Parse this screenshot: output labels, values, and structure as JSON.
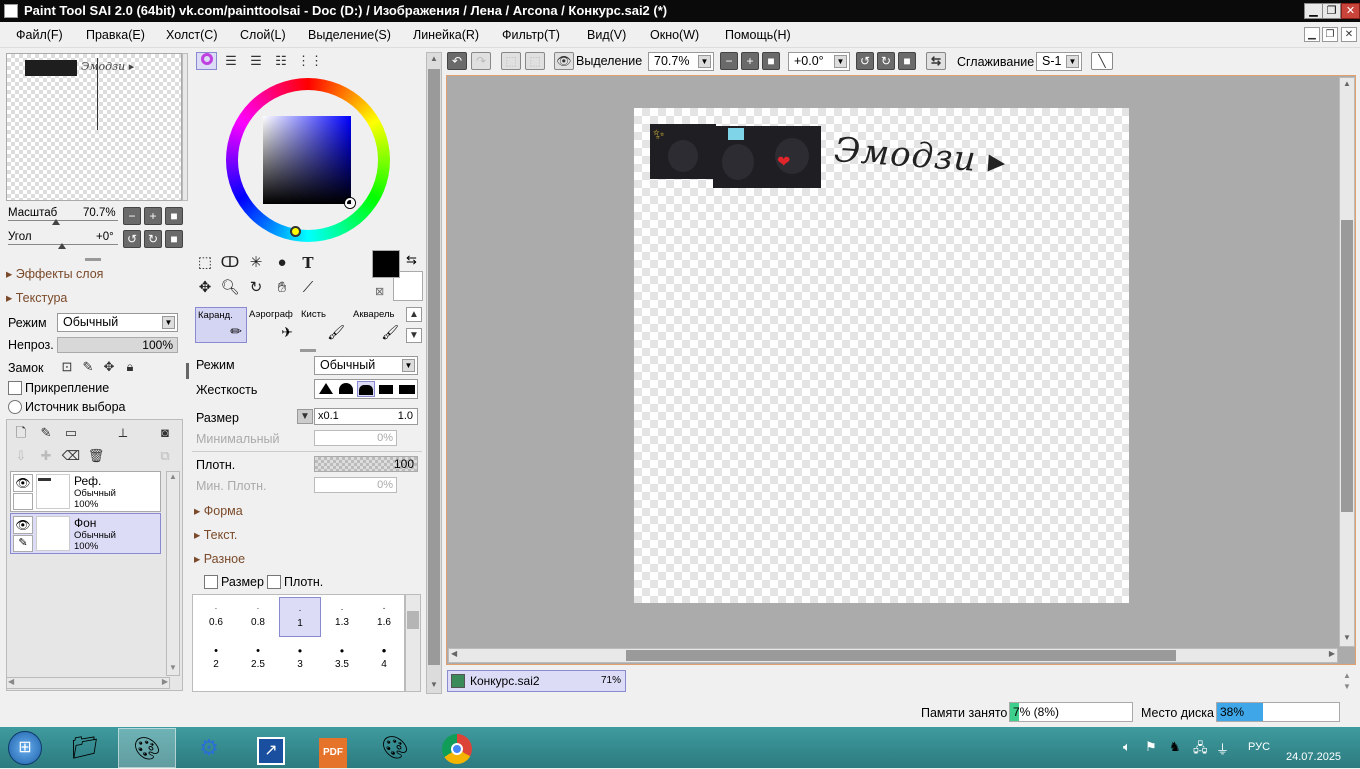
{
  "window": {
    "title": "Paint Tool SAI 2.0 (64bit) vk.com/painttoolsai - Doc (D:) / Изображения / Лена / Arcona / Конкурс.sai2 (*)"
  },
  "menu": [
    "Файл(F)",
    "Правка(E)",
    "Холст(C)",
    "Слой(L)",
    "Выделение(S)",
    "Линейка(R)",
    "Фильтр(T)",
    "Вид(V)",
    "Окно(W)",
    "Помощь(H)"
  ],
  "navigator": {
    "zoom_label": "Масштаб",
    "zoom_value": "70.7%",
    "angle_label": "Угол",
    "angle_value": "+0°"
  },
  "layer_panel": {
    "effects_label": "Эффекты слоя",
    "texture_label": "Текстура",
    "mode_label": "Режим",
    "mode_value": "Обычный",
    "opacity_label": "Непроз.",
    "opacity_value": "100%",
    "lock_label": "Замок",
    "clipping_label": "Прикрепление",
    "selection_source_label": "Источник выбора",
    "layers": [
      {
        "name": "Реф.",
        "mode": "Обычный",
        "opacity": "100%"
      },
      {
        "name": "Фон",
        "mode": "Обычный",
        "opacity": "100%"
      }
    ]
  },
  "brushes": [
    {
      "name": "Каранд."
    },
    {
      "name": "Аэрограф"
    },
    {
      "name": "Кисть"
    },
    {
      "name": "Акварель"
    }
  ],
  "tool_settings": {
    "mode_label": "Режим",
    "mode_value": "Обычный",
    "hardness_label": "Жесткость",
    "size_label": "Размер",
    "size_mult": "x0.1",
    "size_value": "1.0",
    "min_size_label": "Минимальный",
    "min_size_value": "0%",
    "density_label": "Плотн.",
    "density_value": "100",
    "min_density_label": "Мин. Плотн.",
    "min_density_value": "0%",
    "shape_label": "Форма",
    "texture_label": "Текст.",
    "misc_label": "Разное",
    "size_check_label": "Размер",
    "density_check_label": "Плотн.",
    "size_presets": [
      "0.6",
      "0.8",
      "1",
      "1.3",
      "1.6",
      "2",
      "2.5",
      "3",
      "3.5",
      "4"
    ]
  },
  "canvas_toolbar": {
    "selection_label": "Выделение",
    "zoom_value": "70.7%",
    "angle_value": "+0.0°",
    "smoothing_label": "Сглаживание",
    "smoothing_value": "S-1"
  },
  "canvas": {
    "handwritten_text": "Эмодзи ▸",
    "document_tab": "Конкурс.sai2",
    "document_zoom": "71%"
  },
  "statusbar": {
    "memory_label": "Памяти занято",
    "memory_value": "7% (8%)",
    "memory_fraction": 0.07,
    "disk_label": "Место диска",
    "disk_value": "38%",
    "disk_fraction": 0.38
  },
  "taskbar": {
    "language": "РУС",
    "date": "24.07.2025",
    "apps": [
      "start",
      "explorer",
      "paint-tool-sai",
      "network-app",
      "sharex",
      "pdf-app",
      "paint-app",
      "chrome"
    ]
  },
  "colors": {
    "accent": "#e2a070",
    "selection": "#dcdcf7",
    "memory_bar": "#3fcf8c",
    "disk_bar": "#3fa7e8"
  }
}
